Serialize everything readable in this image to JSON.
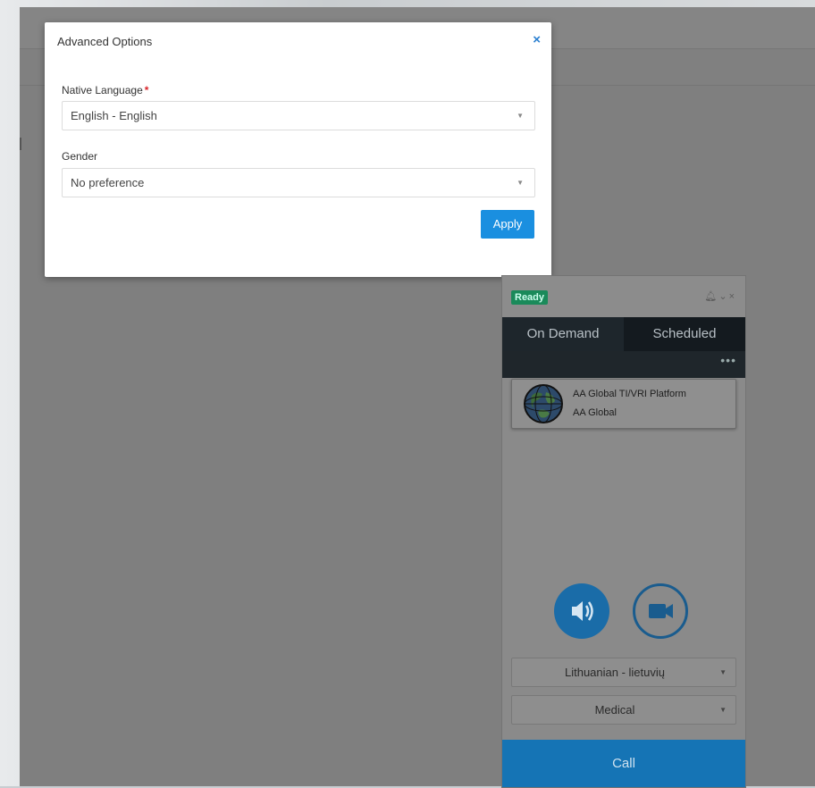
{
  "modal": {
    "title": "Advanced Options",
    "close_glyph": "×",
    "native_language_label": "Native Language",
    "required_marker": "*",
    "native_language_value": "English - English",
    "gender_label": "Gender",
    "gender_value": "No preference",
    "apply_label": "Apply"
  },
  "widget": {
    "status": "Ready",
    "tabs": [
      "On Demand",
      "Scheduled"
    ],
    "more_glyph": "•••",
    "provider": {
      "name": "AA Global TI/VRI Platform",
      "org": "AA Global"
    },
    "language_value": "Lithuanian - lietuvių",
    "specialty_value": "Medical",
    "call_label": "Call"
  },
  "colors": {
    "primary": "#1a8fe0",
    "ready": "#1a8a5a",
    "call": "#1574b5",
    "tab_dark": "#1e262c"
  },
  "icons": [
    "bell-icon",
    "chevron-down-icon",
    "close-icon",
    "speaker-icon",
    "video-camera-icon",
    "globe-icon",
    "caret-down-icon"
  ]
}
